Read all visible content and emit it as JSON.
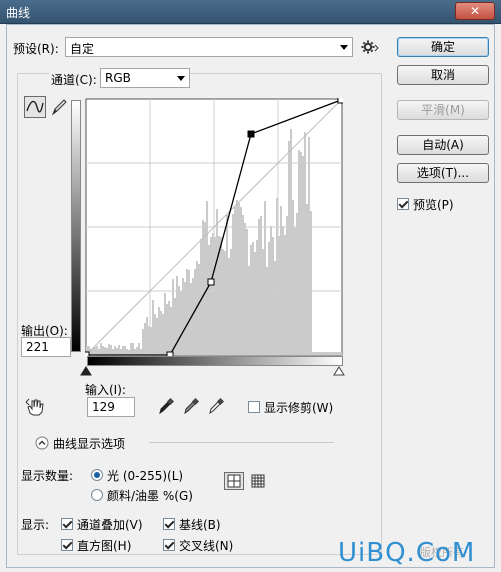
{
  "window": {
    "title": "曲线",
    "close_label": "✕"
  },
  "preset": {
    "label": "预设(R):",
    "value": "自定"
  },
  "channel": {
    "label": "通道(C):",
    "value": "RGB"
  },
  "buttons": {
    "ok": "确定",
    "cancel": "取消",
    "smooth": "平滑(M)",
    "auto": "自动(A)",
    "options": "选项(T)..."
  },
  "preview": {
    "label": "预览(P)",
    "checked": true
  },
  "output": {
    "label": "输出(O):",
    "value": "221"
  },
  "input": {
    "label": "输入(I):",
    "value": "129"
  },
  "show_clipping": {
    "label": "显示修剪(W)",
    "checked": false
  },
  "curve_options": {
    "toggle_label": "曲线显示选项",
    "show_amount_label": "显示数量:",
    "light_label": "光 (0-255)(L)",
    "pigment_label": "颜料/油墨 %(G)",
    "show_label": "显示:",
    "channel_overlays": "通道叠加(V)",
    "baseline": "基线(B)",
    "histogram": "直方图(H)",
    "intersection_line": "交叉线(N)"
  },
  "curve": {
    "points": [
      [
        0,
        0
      ],
      [
        84,
        0
      ],
      [
        125,
        73
      ],
      [
        165,
        221
      ],
      [
        255,
        255
      ]
    ],
    "selected_point": [
      129,
      221
    ]
  },
  "watermark": {
    "text": "UiBQ.CoM",
    "sub": "版权所有"
  }
}
